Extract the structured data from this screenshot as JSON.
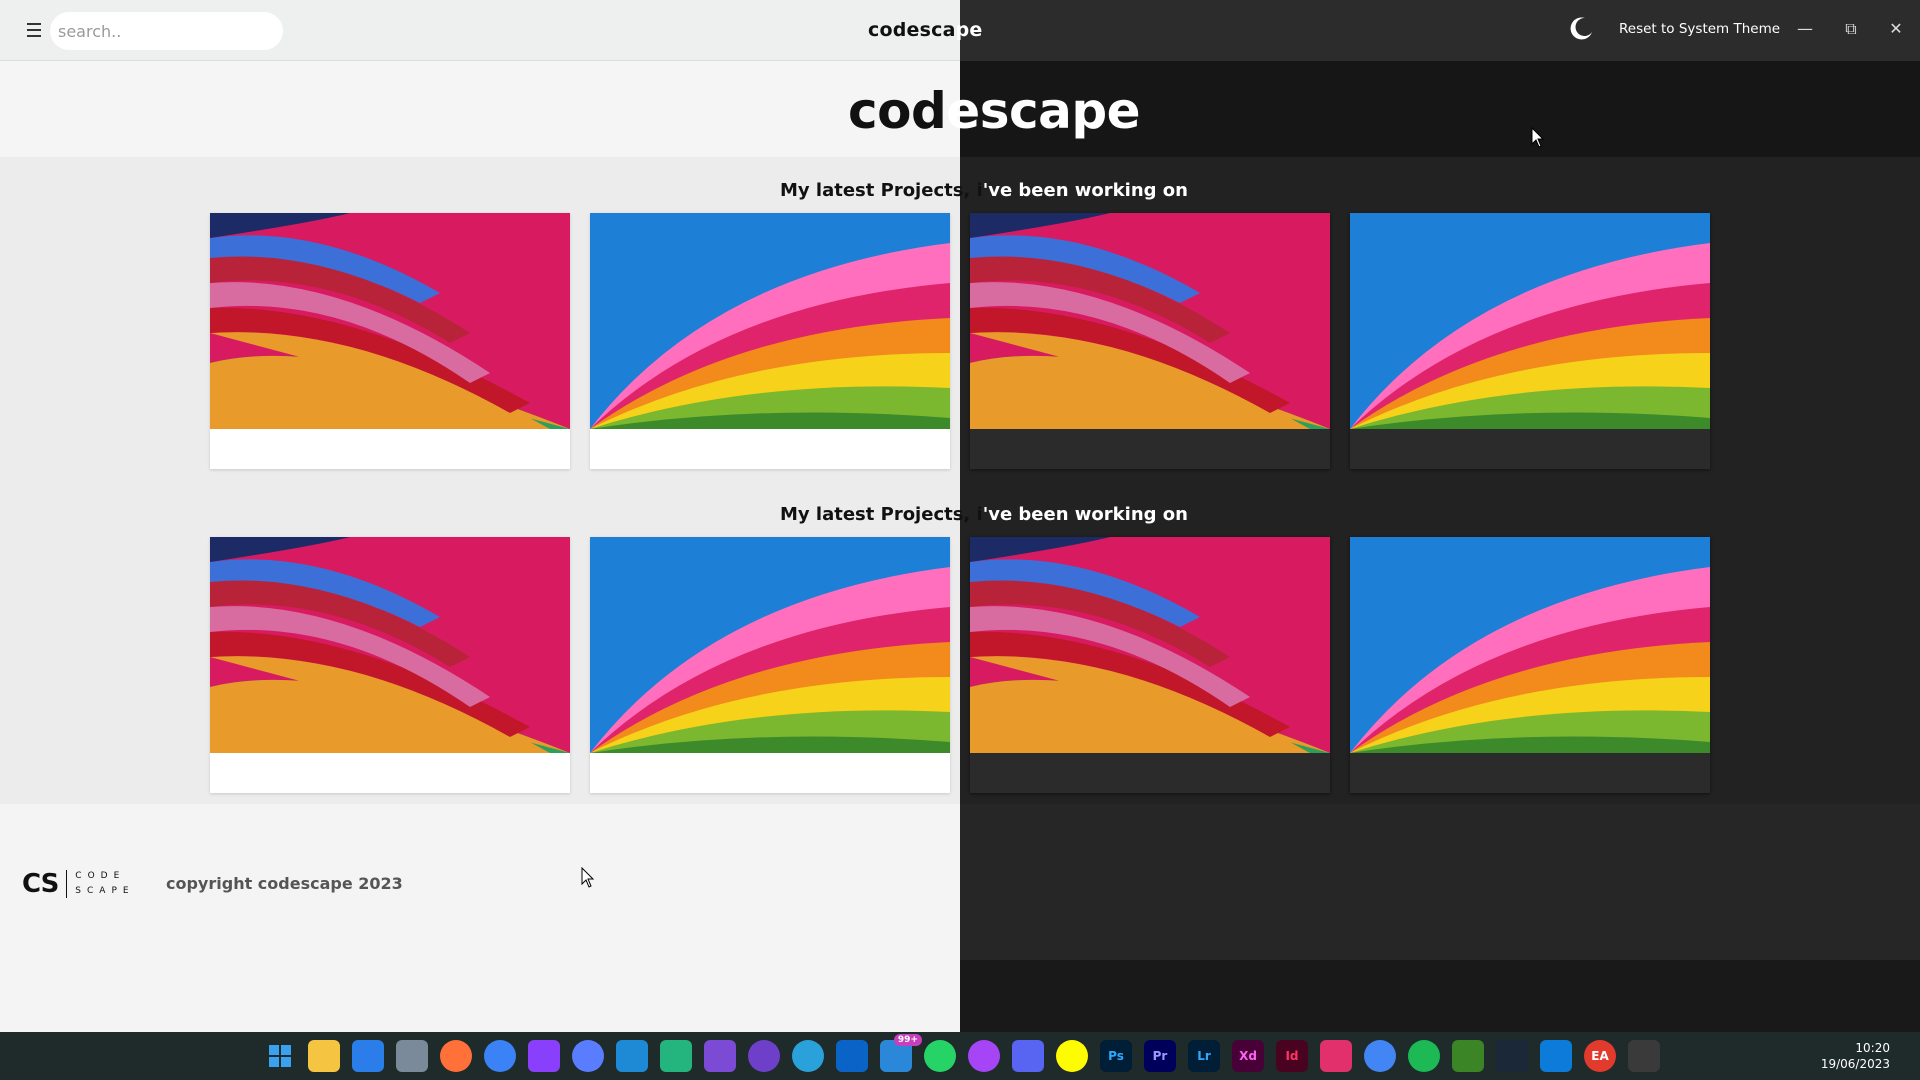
{
  "topbar": {
    "search_placeholder": "search..",
    "title_light": "codesca",
    "title_dark": "pe",
    "reset_theme": "Reset to System Theme"
  },
  "hero": {
    "title_light": "cod",
    "title_dark": "escape"
  },
  "sections": [
    {
      "heading_light": "My latest Projects, i",
      "heading_dark": "'ve been working on"
    },
    {
      "heading_light": "My latest Projects, i",
      "heading_dark": "'ve been working on"
    }
  ],
  "footer": {
    "logo_mark": "CS",
    "logo_word_1": "CODE",
    "logo_word_2": "SCAPE",
    "copyright": "copyright codescape 2023"
  },
  "taskbar": {
    "icons": [
      "windows-start",
      "file-explorer",
      "microsoft-store",
      "settings",
      "firefox",
      "firefox-dev",
      "mask-app",
      "firefox-blue",
      "vscode",
      "vscode-insiders",
      "house-app",
      "github",
      "telegram",
      "outlook",
      "mail",
      "whatsapp",
      "messenger",
      "discord",
      "snapchat",
      "photoshop",
      "premiere",
      "lightroom",
      "xd",
      "indesign",
      "instagram",
      "chrome",
      "spotify",
      "minecraft",
      "steam",
      "bing",
      "ea",
      "terminal"
    ],
    "mail_badge": "99+",
    "icon_labels": {
      "ps": "Ps",
      "pr": "Pr",
      "lr": "Lr",
      "xd": "Xd",
      "id": "Id",
      "ea": "EA"
    }
  },
  "clock": {
    "time": "10:20",
    "date": "19/06/2023"
  },
  "colors": {
    "light_bg": "#f4f4f4",
    "dark_bg": "#262626",
    "accent": "#e0246b"
  }
}
